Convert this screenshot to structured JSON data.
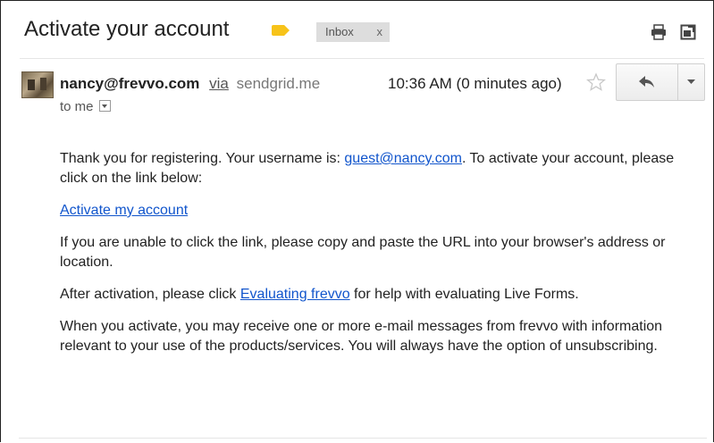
{
  "header": {
    "subject": "Activate your account",
    "label_color": "#f7c31a",
    "inbox_chip": {
      "label": "Inbox",
      "remove_glyph": "x"
    },
    "icons": [
      "print-icon",
      "new-window-icon"
    ]
  },
  "message": {
    "sender_email": "nancy@frevvo.com",
    "via_label": "via",
    "via_domain": "sendgrid.me",
    "time": "10:36 AM (0 minutes ago)",
    "recipient": "to me",
    "avatar_icon": "sender-avatar",
    "actions": [
      "star-icon",
      "reply-icon",
      "more-icon"
    ]
  },
  "body": {
    "p1_text": "Thank you for registering. Your username is: ",
    "p1_username": "guest@nancy.com",
    "p1_rest": ". To activate your account, please click on the link below:",
    "activate_link": "Activate my account",
    "p2": "If you are unable to click the link, please copy and paste the URL into your browser's address or location.",
    "p3_text": "After activation, please click ",
    "p3_link": "Evaluating frevvo",
    "p3_rest": " for help with evaluating Live Forms.",
    "p4": "When you activate, you may receive one or more e-mail messages from frevvo with information relevant to your use of the products/services. You will always have the option of unsubscribing."
  },
  "colors": {
    "link": "#1155cc",
    "chip_bg": "#dddddd"
  }
}
